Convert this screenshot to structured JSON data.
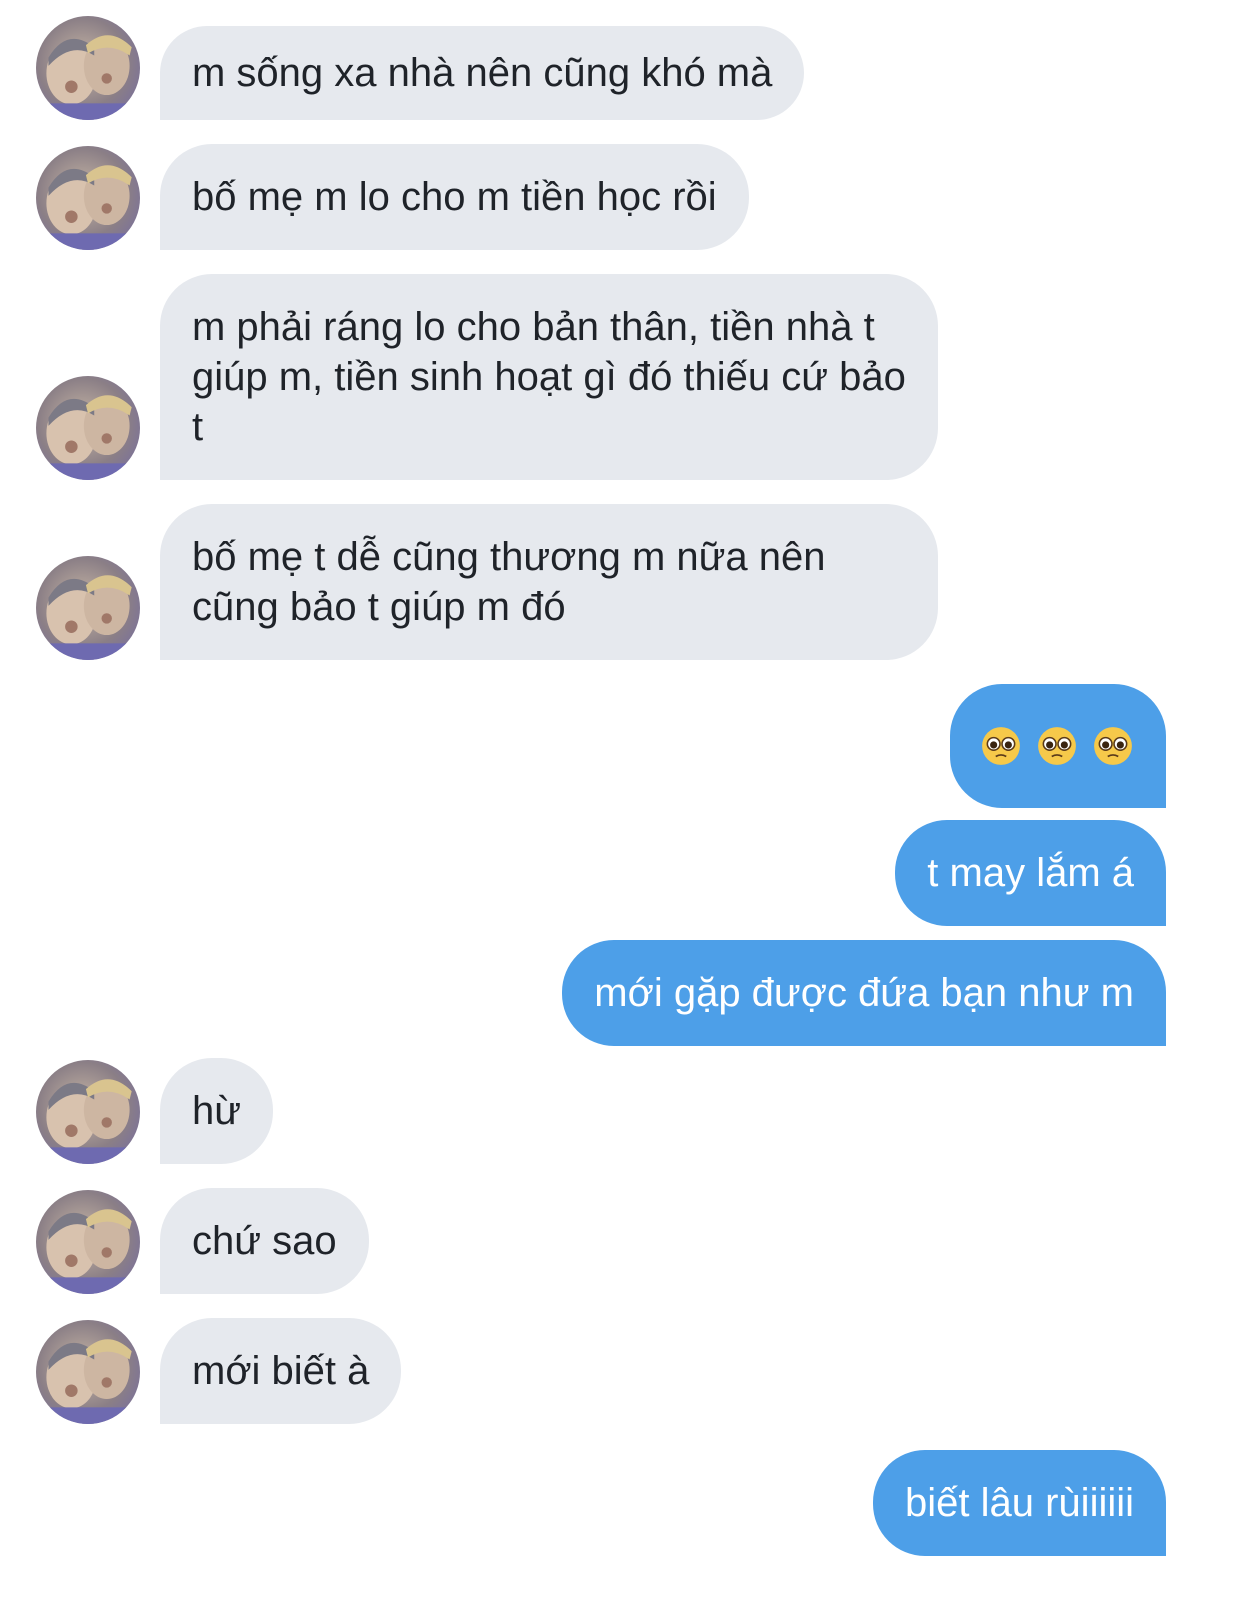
{
  "colors": {
    "incoming_bubble": "#e6e9ee",
    "outgoing_bubble": "#4d9fe8",
    "incoming_text": "#1f2329",
    "outgoing_text": "#ffffff"
  },
  "messages": [
    {
      "sender": "them",
      "text": "m sống xa nhà nên cũng khó mà"
    },
    {
      "sender": "them",
      "text": "bố mẹ m lo cho m tiền học rồi"
    },
    {
      "sender": "them",
      "text": "m phải ráng lo cho bản thân, tiền nhà t giúp m, tiền sinh hoạt gì đó thiếu cứ bảo t"
    },
    {
      "sender": "them",
      "text": "bố mẹ t dễ cũng thương m nữa nên cũng bảo t giúp m đó"
    },
    {
      "sender": "me",
      "emoji": [
        "pleading-face-icon",
        "pleading-face-icon",
        "pleading-face-icon"
      ]
    },
    {
      "sender": "me",
      "text": "t may lắm á"
    },
    {
      "sender": "me",
      "text": "mới gặp được đứa bạn như m"
    },
    {
      "sender": "them",
      "text": "hừ"
    },
    {
      "sender": "them",
      "text": "chứ sao"
    },
    {
      "sender": "them",
      "text": "mới biết à"
    },
    {
      "sender": "me",
      "text": "biết lâu rùiiiiii"
    }
  ]
}
